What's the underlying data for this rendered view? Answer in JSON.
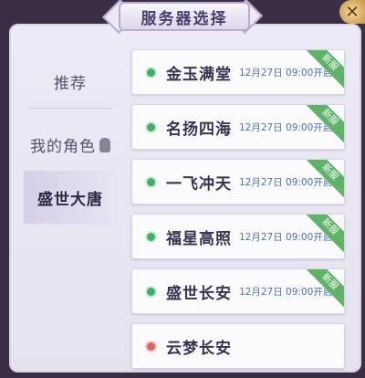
{
  "header": {
    "title": "服务器选择",
    "close_symbol": "✕"
  },
  "sidebar": {
    "items": [
      {
        "label": "推荐"
      },
      {
        "label": "我的角色"
      },
      {
        "label": "盛世大唐"
      }
    ]
  },
  "servers": [
    {
      "name": "金玉满堂",
      "time": "12月27日 09:00开启",
      "badge": "新服",
      "status": "green"
    },
    {
      "name": "名扬四海",
      "time": "12月27日 09:00开启",
      "badge": "新服",
      "status": "green"
    },
    {
      "name": "一飞冲天",
      "time": "12月27日 09:00开启",
      "badge": "新服",
      "status": "green"
    },
    {
      "name": "福星高照",
      "time": "12月27日 09:00开启",
      "badge": "新服",
      "status": "green"
    },
    {
      "name": "盛世长安",
      "time": "12月27日 09:00开启",
      "badge": "新服",
      "status": "green"
    },
    {
      "name": "云梦长安",
      "status": "red"
    }
  ],
  "colors": {
    "accent": "#5fb267",
    "time_text": "#4a74c2",
    "status_open": "#3fb06a",
    "status_full": "#e06363"
  }
}
